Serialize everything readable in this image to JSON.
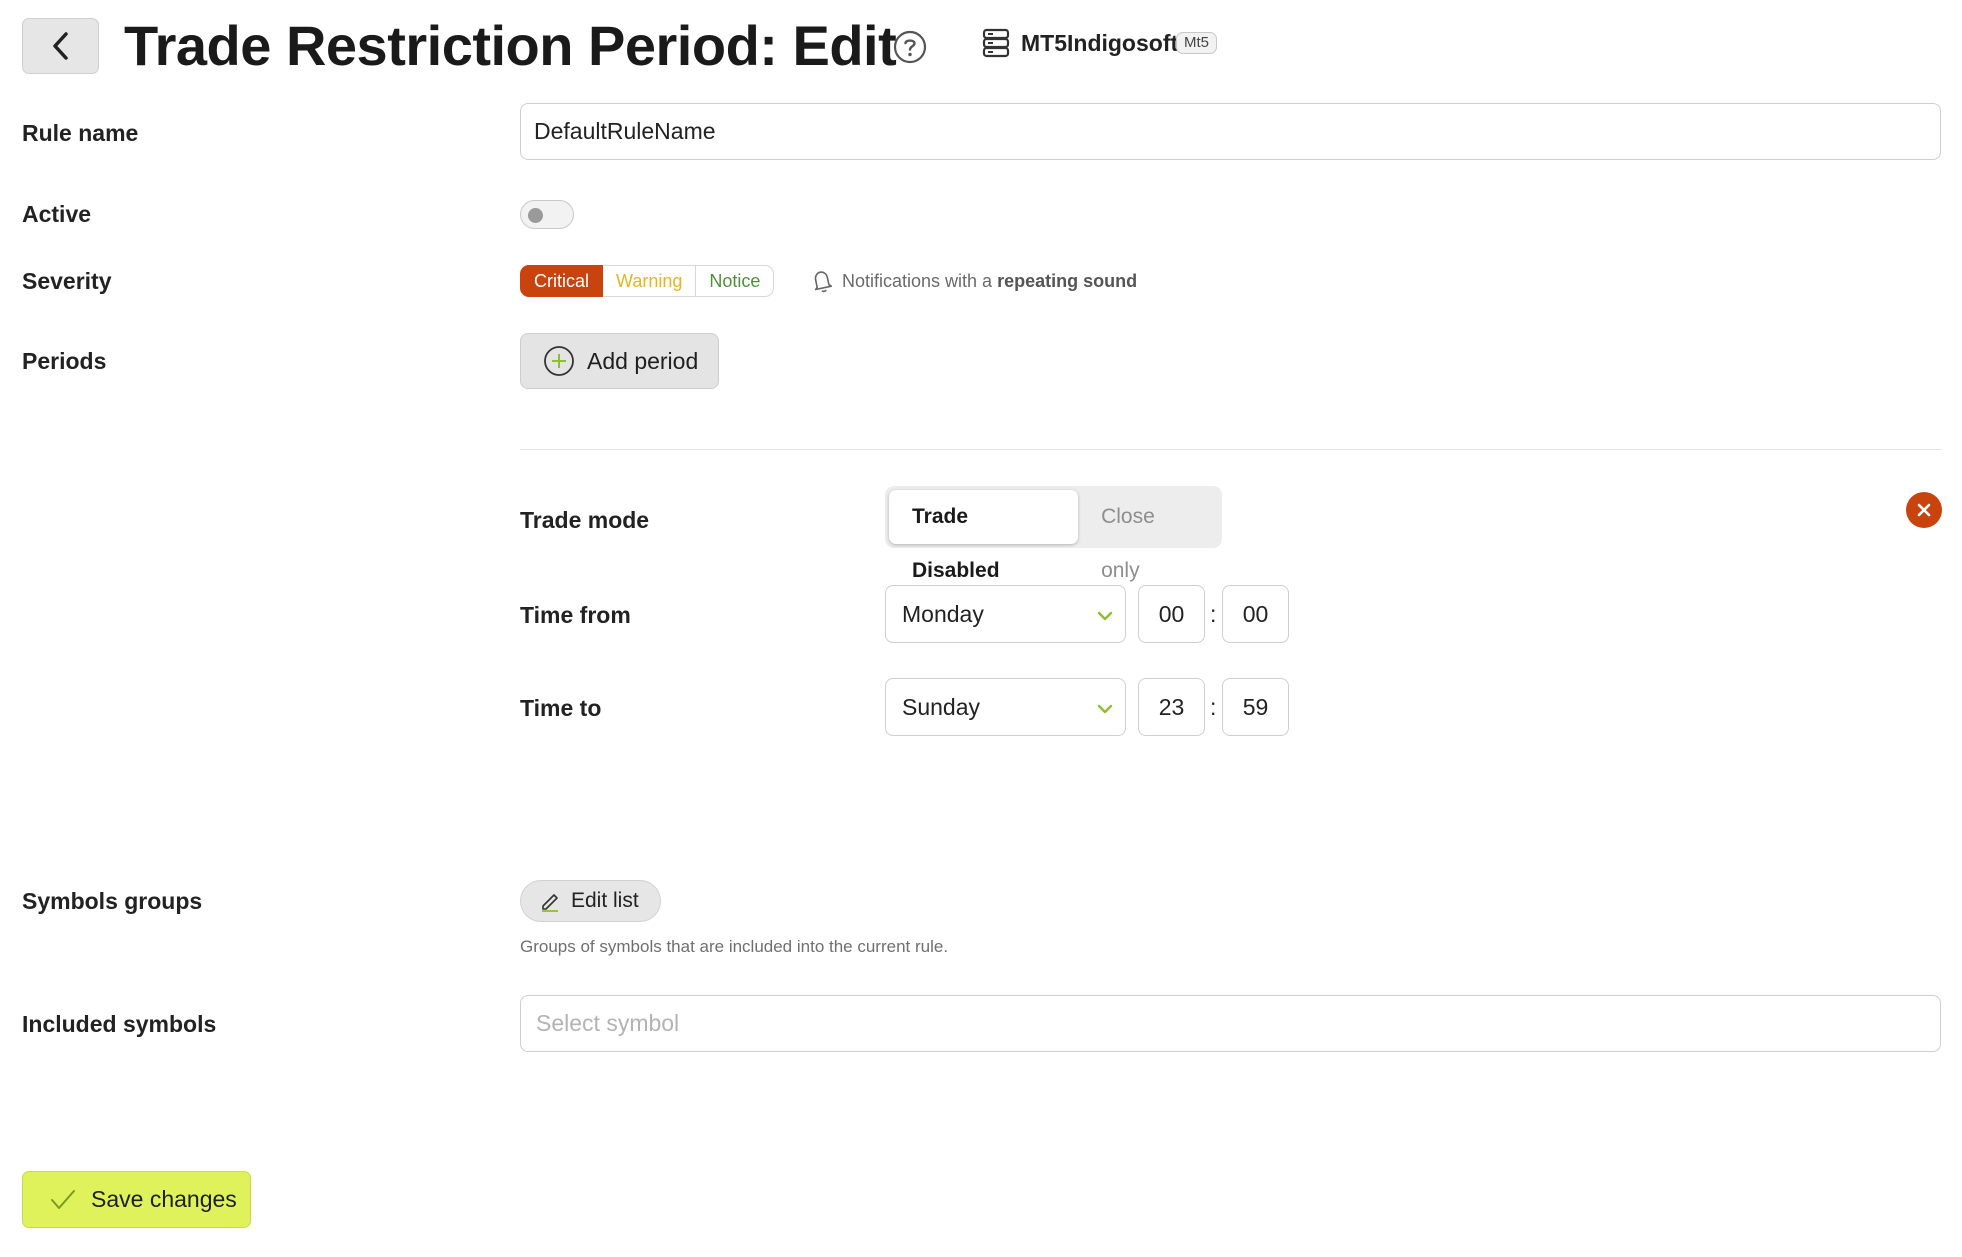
{
  "header": {
    "title": "Trade Restriction Period: Edit",
    "server_name": "MT5Indigosoft",
    "server_badge": "Mt5",
    "icons": {
      "back": "chevron-left-icon",
      "help": "question-circle-icon",
      "server": "server-icon"
    }
  },
  "form": {
    "rule_name": {
      "label": "Rule name",
      "value": "DefaultRuleName"
    },
    "active": {
      "label": "Active",
      "checked": false
    },
    "severity": {
      "label": "Severity",
      "options": [
        "Critical",
        "Warning",
        "Notice"
      ],
      "selected": "Critical",
      "colors": {
        "critical": "#c9430e",
        "warning": "#e3b526",
        "notice": "#4f8f3a"
      },
      "note_prefix": "Notifications with a",
      "note_bold": "repeating sound"
    },
    "periods": {
      "label": "Periods",
      "add_label": "Add period",
      "items": [
        {
          "trade_mode": {
            "label": "Trade mode",
            "options": [
              "Trade Disabled",
              "Close only"
            ],
            "selected": "Trade Disabled"
          },
          "time_from": {
            "label": "Time from",
            "day": "Monday",
            "hour": "00",
            "minute": "00"
          },
          "time_to": {
            "label": "Time to",
            "day": "Sunday",
            "hour": "23",
            "minute": "59"
          }
        }
      ]
    },
    "symbols_groups": {
      "label": "Symbols groups",
      "button_label": "Edit list",
      "help": "Groups of symbols that are included into the current rule."
    },
    "included_symbols": {
      "label": "Included symbols",
      "placeholder": "Select symbol"
    }
  },
  "footer": {
    "save_label": "Save changes",
    "accent": "#dff25c"
  }
}
